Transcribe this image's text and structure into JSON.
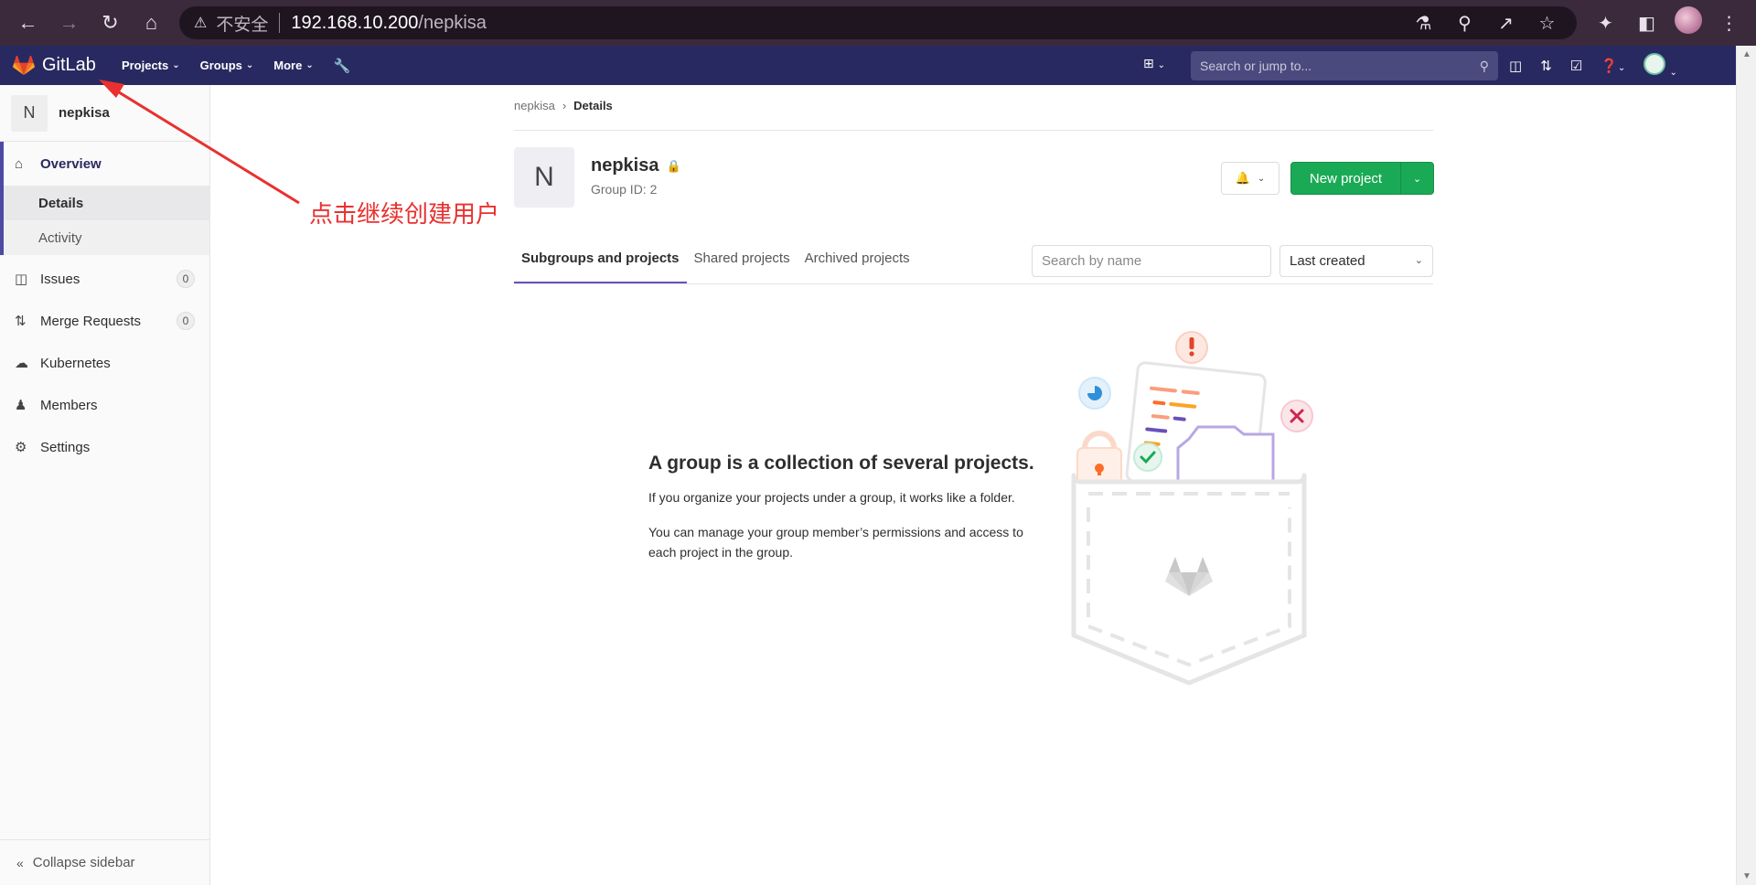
{
  "browser": {
    "security_label": "不安全",
    "url_host": "192.168.10.200",
    "url_path": "/nepkisa"
  },
  "topnav": {
    "brand": "GitLab",
    "menu": [
      "Projects",
      "Groups",
      "More"
    ],
    "search_placeholder": "Search or jump to..."
  },
  "sidebar": {
    "group_initial": "N",
    "group_name": "nepkisa",
    "overview": "Overview",
    "details": "Details",
    "activity": "Activity",
    "issues": "Issues",
    "issues_count": "0",
    "merge_requests": "Merge Requests",
    "merge_requests_count": "0",
    "kubernetes": "Kubernetes",
    "members": "Members",
    "settings": "Settings",
    "collapse": "Collapse sidebar"
  },
  "breadcrumb": {
    "parent": "nepkisa",
    "separator": "›",
    "current": "Details"
  },
  "group": {
    "initial": "N",
    "name": "nepkisa",
    "id_label": "Group ID: 2"
  },
  "actions": {
    "new_project": "New project"
  },
  "tabs": [
    "Subgroups and projects",
    "Shared projects",
    "Archived projects"
  ],
  "filter": {
    "search_placeholder": "Search by name",
    "sort_selected": "Last created"
  },
  "empty_state": {
    "title": "A group is a collection of several projects.",
    "p1": "If you organize your projects under a group, it works like a folder.",
    "p2": "You can manage your group member’s permissions and access to each project in the group."
  },
  "annotation": {
    "text": "点击继续创建用户",
    "color": "#e8312f"
  },
  "colors": {
    "nav_bg": "#292961",
    "primary_green": "#1aaa55",
    "active_tab": "#6b4fbb"
  }
}
